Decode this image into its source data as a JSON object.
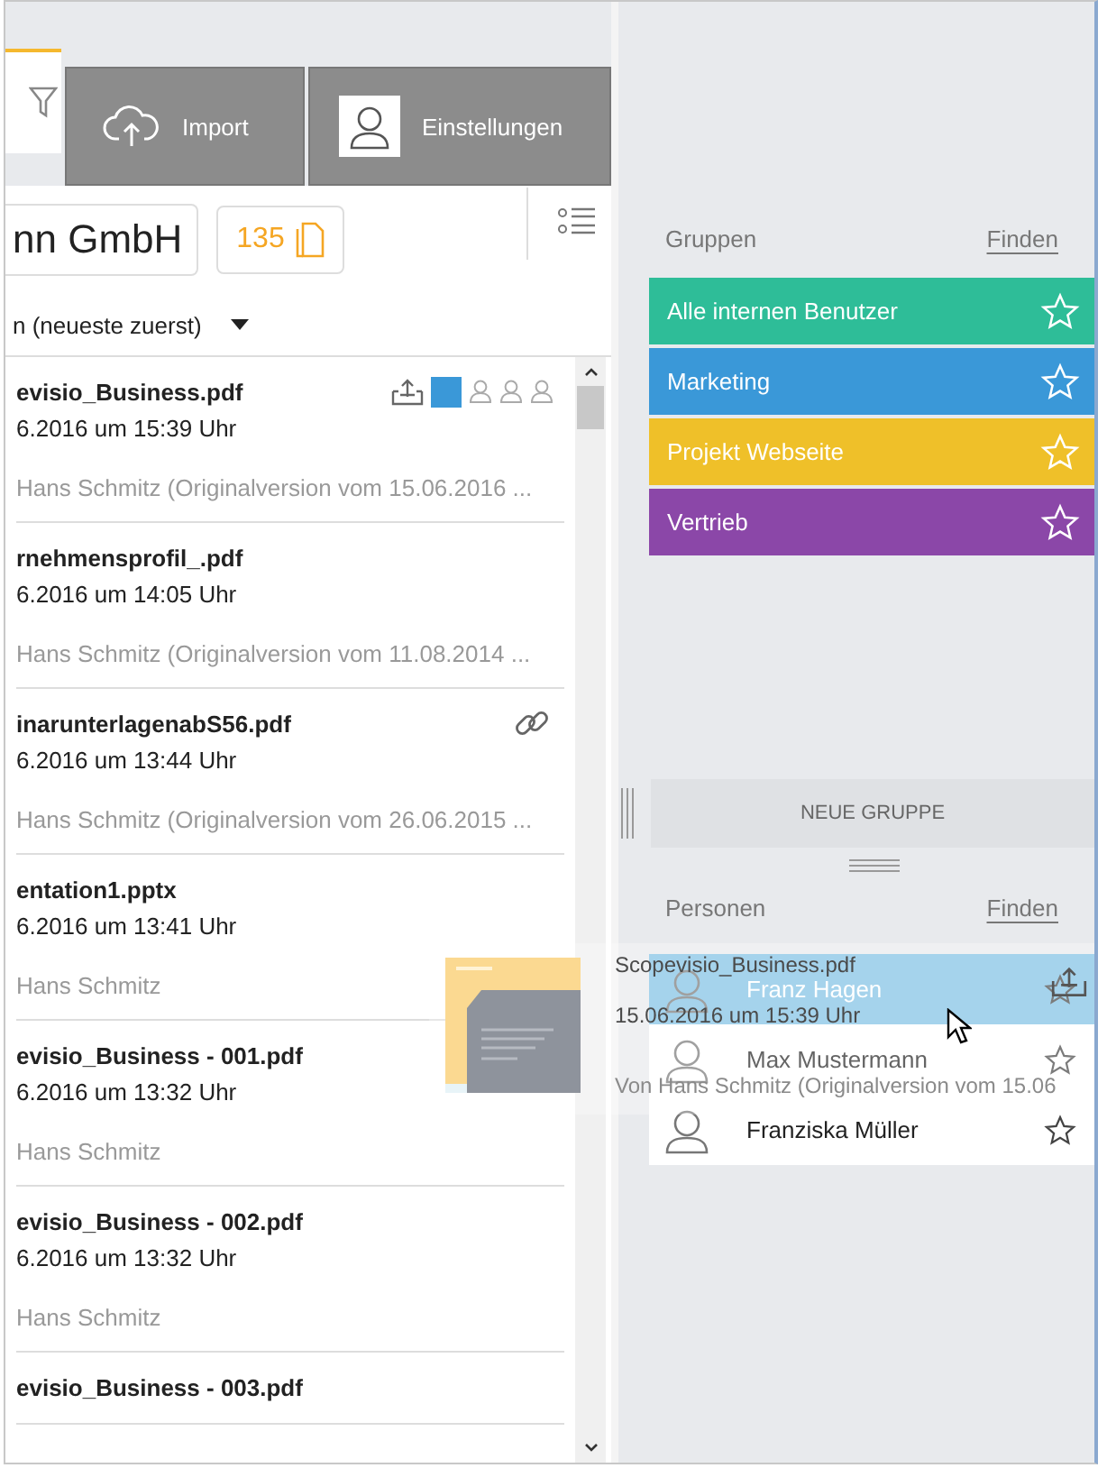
{
  "toolbar": {
    "buttons": [
      {
        "label": "Import",
        "kind": "import"
      },
      {
        "label": "Einstellungen",
        "kind": "settings"
      }
    ]
  },
  "company": "nn GmbH",
  "count": "135",
  "sort": "n (neueste zuerst)",
  "documents": [
    {
      "name": "evisio_Business.pdf",
      "date": "6.2016 um 15:39 Uhr",
      "author": "Hans Schmitz (Originalversion vom 15.06.2016 ...",
      "kind": "shared"
    },
    {
      "name": "rnehmensprofil_.pdf",
      "date": "6.2016 um 14:05 Uhr",
      "author": "Hans Schmitz (Originalversion vom 11.08.2014 ...",
      "kind": "plain"
    },
    {
      "name": "inarunterlagenabS56.pdf",
      "date": "6.2016 um 13:44 Uhr",
      "author": "Hans Schmitz (Originalversion vom 26.06.2015 ...",
      "kind": "linked"
    },
    {
      "name": "entation1.pptx",
      "date": "6.2016 um 13:41 Uhr",
      "author": "Hans Schmitz",
      "kind": "plain"
    },
    {
      "name": "evisio_Business - 001.pdf",
      "date": "6.2016 um 13:32 Uhr",
      "author": "Hans Schmitz",
      "kind": "plain"
    },
    {
      "name": "evisio_Business - 002.pdf",
      "date": "6.2016 um 13:32 Uhr",
      "author": "Hans Schmitz",
      "kind": "plain"
    },
    {
      "name": "evisio_Business - 003.pdf",
      "kind": "plain"
    }
  ],
  "groups": {
    "title": "Gruppen",
    "find": "Finden",
    "new_button": "NEUE GRUPPE",
    "items": [
      {
        "label": "Alle internen Benutzer",
        "color": "#2ebd98"
      },
      {
        "label": "Marketing",
        "color": "#3a98d8"
      },
      {
        "label": "Projekt Webseite",
        "color": "#efc029"
      },
      {
        "label": "Vertrieb",
        "color": "#8b47a8"
      }
    ]
  },
  "people": {
    "title": "Personen",
    "find": "Finden",
    "items": [
      {
        "name": "Franz Hagen",
        "selected": true
      },
      {
        "name": "Max Mustermann",
        "selected": false
      },
      {
        "name": "Franziska Müller",
        "selected": false
      }
    ]
  },
  "drag_preview": {
    "kind": "picture",
    "name": "Scopevisio_Business.pdf",
    "date": "15.06.2016 um 15:39 Uhr",
    "author": "Von Hans Schmitz (Originalversion vom 15.06"
  }
}
